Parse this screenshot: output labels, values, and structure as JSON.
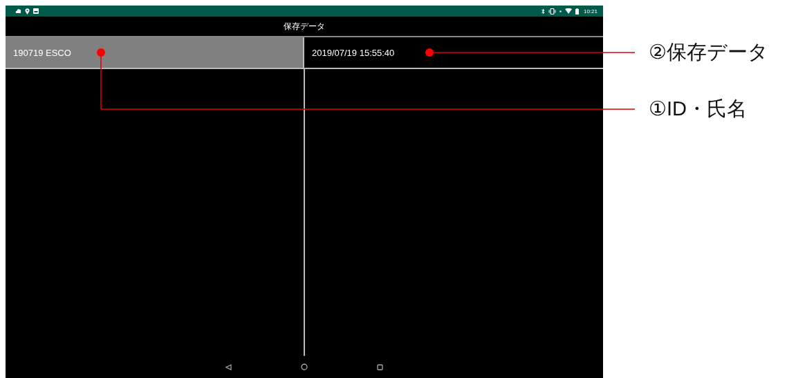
{
  "status_bar": {
    "time": "10:21"
  },
  "title_bar": {
    "title": "保存データ"
  },
  "rows": [
    {
      "id_name": "190719 ESCO",
      "saved_at": "2019/07/19 15:55:40",
      "selected": true
    }
  ],
  "annotations": [
    {
      "label": "②保存データ"
    },
    {
      "label": "①ID・氏名"
    }
  ]
}
